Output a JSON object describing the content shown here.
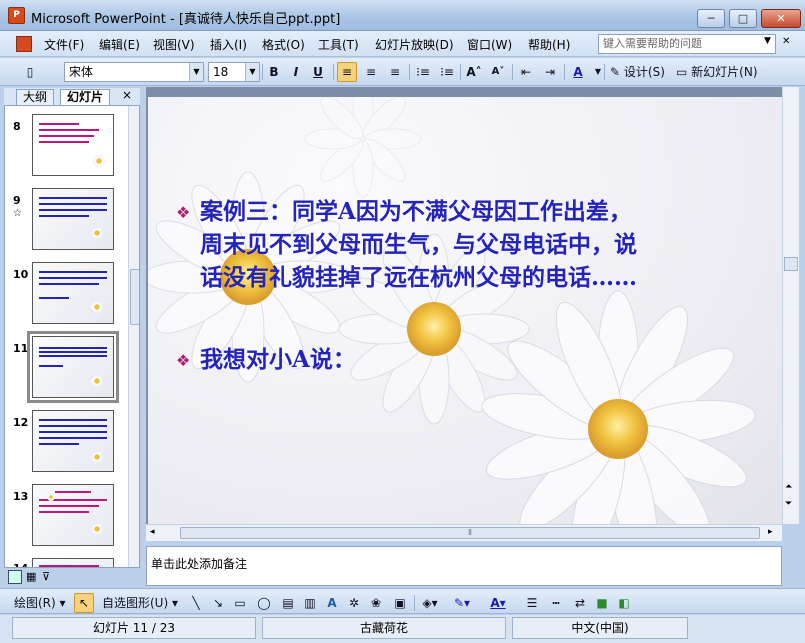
{
  "window": {
    "title": "Microsoft PowerPoint - [真诚待人快乐自己ppt.ppt]",
    "app_icon_text": "P",
    "btn_minimize": "─",
    "btn_maximize": "□",
    "btn_close": "✕"
  },
  "menu": {
    "items": [
      "文件(F)",
      "编辑(E)",
      "视图(V)",
      "插入(I)",
      "格式(O)",
      "工具(T)",
      "幻灯片放映(D)",
      "窗口(W)",
      "帮助(H)"
    ],
    "help_placeholder": "键入需要帮助的问题"
  },
  "toolbar": {
    "font_name": "宋体",
    "font_size": "18",
    "bold": "B",
    "italic": "I",
    "underline": "U",
    "design_label": "设计(S)",
    "new_slide_label": "新幻灯片(N)"
  },
  "panel": {
    "tab_outline": "大纲",
    "tab_slides": "幻灯片",
    "close": "×",
    "slides": [
      {
        "num": "8"
      },
      {
        "num": "9",
        "marker": "☆"
      },
      {
        "num": "10"
      },
      {
        "num": "11"
      },
      {
        "num": "12"
      },
      {
        "num": "13"
      },
      {
        "num": "14"
      }
    ]
  },
  "slide": {
    "bullet1": "案例三：同学A因为不满父母因工作出差，周末见不到父母而生气，与父母电话中，说话没有礼貌挂掉了远在杭州父母的电话……",
    "bullet1_lines": [
      "案例三：同学A因为不满父母因工作出差，",
      "周末见不到父母而生气，与父母电话中，说",
      "话没有礼貌挂掉了远在杭州父母的电话……"
    ],
    "bullet2": "我想对小A说：",
    "bullet_symbol": "❖"
  },
  "notes": {
    "placeholder": "单击此处添加备注"
  },
  "drawbar": {
    "draw_label": "绘图(R)",
    "autoshape_label": "自选图形(U)"
  },
  "status": {
    "slide_pos": "幻灯片 11 / 23",
    "design": "古藏荷花",
    "language": "中文(中国)"
  },
  "colors": {
    "slide_text": "#2424b8",
    "bullet": "#b01c6e",
    "titlebar": "#a9c4e4"
  }
}
